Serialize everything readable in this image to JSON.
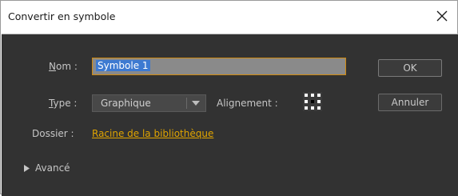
{
  "window": {
    "title": "Convertir en symbole",
    "close_icon": "close-icon"
  },
  "form": {
    "name_label_accel": "N",
    "name_label_rest": "om :",
    "name_value": "Symbole 1",
    "type_label_accel": "T",
    "type_label_rest": "ype :",
    "type_value": "Graphique",
    "alignment_label": "Alignement :",
    "folder_label": "Dossier :",
    "folder_value": "Racine de la bibliothèque",
    "advanced_label": "Avancé"
  },
  "buttons": {
    "ok_label": "OK",
    "cancel_label": "Annuler"
  },
  "colors": {
    "panel_bg": "#323232",
    "accent_link": "#e0a400",
    "focus_border": "#d08a10",
    "selection": "#3d7ad1"
  }
}
